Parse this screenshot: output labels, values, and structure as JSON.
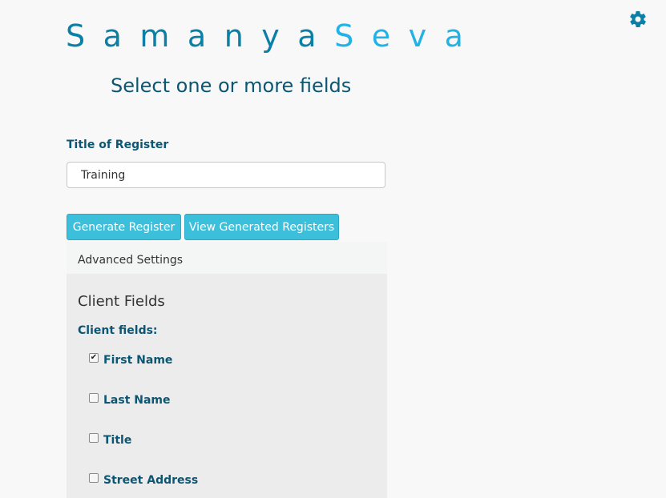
{
  "brand": {
    "part1": "SamanyaSeva",
    "part1_display": "Samanya",
    "part2_display": "Seva",
    "color_primary": "#0b7fa5",
    "color_accent": "#22b3e6"
  },
  "header": {
    "settings_icon": "gear-icon"
  },
  "page": {
    "subtitle": "Select one or more fields"
  },
  "form": {
    "title_label": "Title of Register",
    "title_value": "Training",
    "generate_button": "Generate Register",
    "view_button": "View Generated Registers"
  },
  "advanced": {
    "header": "Advanced Settings",
    "section_title": "Client Fields",
    "fields_label": "Client fields:",
    "fields": [
      {
        "label": "First Name",
        "checked": true
      },
      {
        "label": "Last Name",
        "checked": false
      },
      {
        "label": "Title",
        "checked": false
      },
      {
        "label": "Street Address",
        "checked": false
      }
    ]
  },
  "colors": {
    "button_bg": "#3cbfdb",
    "heading_text": "#0c5673"
  }
}
